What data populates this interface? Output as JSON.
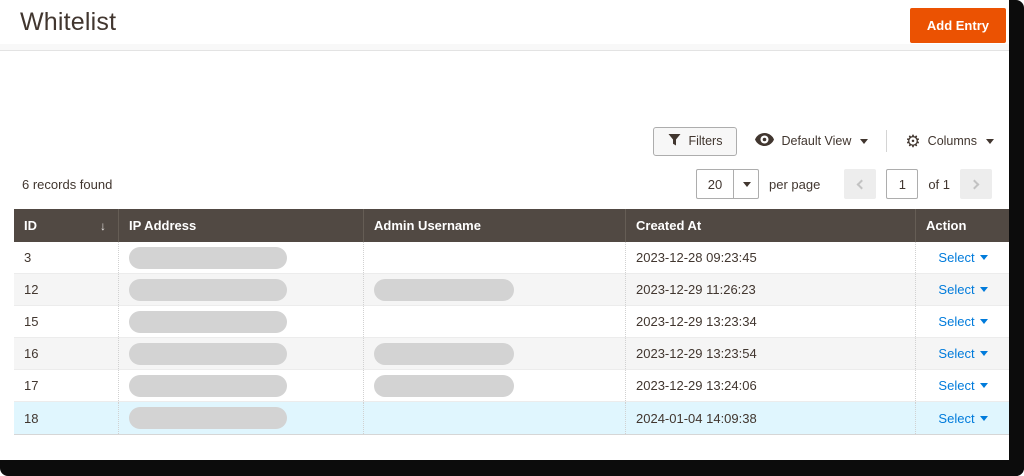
{
  "page": {
    "title": "Whitelist"
  },
  "actions": {
    "add_entry": "Add Entry"
  },
  "toolbar": {
    "filters_label": "Filters",
    "view_label": "Default View",
    "columns_label": "Columns"
  },
  "grid": {
    "records_found": "6 records found",
    "pagination": {
      "page_size": "20",
      "per_page_label": "per page",
      "current_page": "1",
      "total_label": "of 1"
    },
    "columns": {
      "id": "ID",
      "ip": "IP Address",
      "username": "Admin Username",
      "created": "Created At",
      "action": "Action"
    },
    "sort_icon": "↓",
    "select_label": "Select",
    "rows": [
      {
        "id": "3",
        "ip_redacted": true,
        "username_redacted": false,
        "created_at": "2023-12-28 09:23:45"
      },
      {
        "id": "12",
        "ip_redacted": true,
        "username_redacted": true,
        "created_at": "2023-12-29 11:26:23"
      },
      {
        "id": "15",
        "ip_redacted": true,
        "username_redacted": false,
        "created_at": "2023-12-29 13:23:34"
      },
      {
        "id": "16",
        "ip_redacted": true,
        "username_redacted": true,
        "created_at": "2023-12-29 13:23:54"
      },
      {
        "id": "17",
        "ip_redacted": true,
        "username_redacted": true,
        "created_at": "2023-12-29 13:24:06"
      },
      {
        "id": "18",
        "ip_redacted": true,
        "username_redacted": false,
        "created_at": "2024-01-04 14:09:38",
        "highlighted": true
      }
    ]
  },
  "colors": {
    "primary_button": "#eb5202",
    "link": "#007bdb",
    "grid_header_bg": "#514943",
    "row_stripe": "#f5f5f5",
    "row_highlight": "#e0f6fe"
  }
}
